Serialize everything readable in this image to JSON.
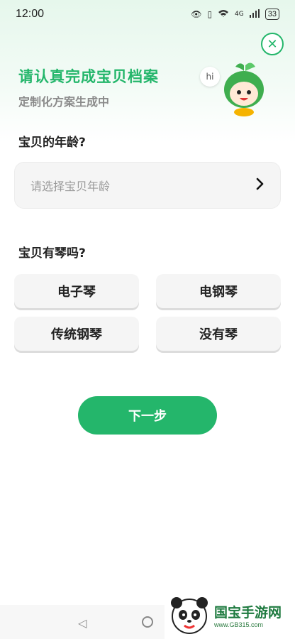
{
  "status_bar": {
    "time": "12:00",
    "network": "4G",
    "battery": "33"
  },
  "header": {
    "title": "请认真完成宝贝档案",
    "subtitle": "定制化方案生成中",
    "bubble_text": "hi"
  },
  "age_section": {
    "label": "宝贝的年龄?",
    "placeholder": "请选择宝贝年龄"
  },
  "piano_section": {
    "label": "宝贝有琴吗?",
    "options": [
      "电子琴",
      "电钢琴",
      "传统钢琴",
      "没有琴"
    ]
  },
  "next_button": {
    "label": "下一步"
  },
  "watermark": {
    "title": "国宝手游网",
    "url": "www.GB315.com"
  },
  "colors": {
    "accent": "#24b66b",
    "button_bg": "#f5f5f5"
  }
}
